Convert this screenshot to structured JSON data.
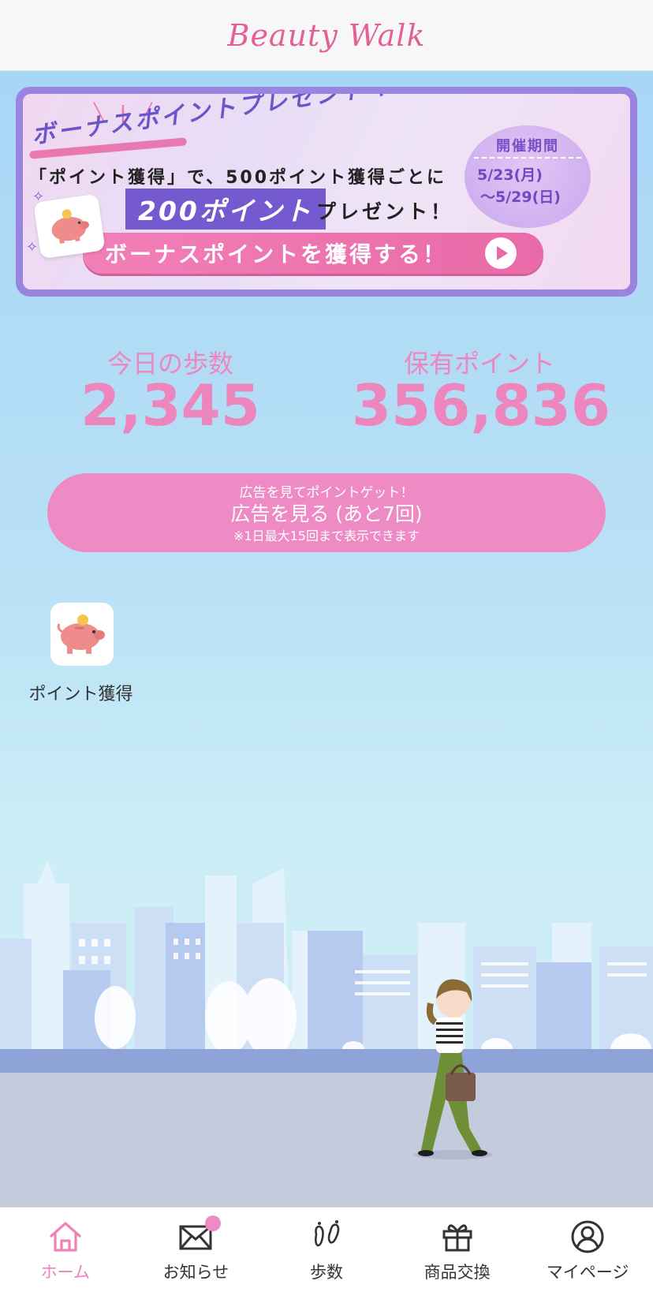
{
  "app": {
    "logo": "Beauty Walk"
  },
  "banner": {
    "title": "ボーナスポイントプレゼントキャンペーン",
    "line1": "「ポイント獲得」で、500ポイント獲得ごとに",
    "highlight": "200ポイント",
    "line2": "プレゼント！",
    "period_title": "開催期間",
    "period_start": "5/23(月)",
    "period_end": "〜5/29(日)",
    "cta": "ボーナスポイントを獲得する！"
  },
  "stats": {
    "steps_label": "今日の歩数",
    "steps_value": "2,345",
    "points_label": "保有ポイント",
    "points_value": "356,836"
  },
  "ad": {
    "sub": "広告を見てポイントゲット！",
    "main": "広告を見る (あと7回)",
    "note": "※1日最大15回まで表示できます"
  },
  "shortcut": {
    "label": "ポイント獲得"
  },
  "tabs": [
    {
      "label": "ホーム",
      "icon": "home-icon",
      "active": true
    },
    {
      "label": "お知らせ",
      "icon": "mail-icon",
      "badge": true
    },
    {
      "label": "歩数",
      "icon": "footprints-icon"
    },
    {
      "label": "商品交換",
      "icon": "gift-icon"
    },
    {
      "label": "マイページ",
      "icon": "user-icon"
    }
  ],
  "colors": {
    "accent": "#ee86be",
    "banner_purple": "#7459cf",
    "sky": "#a8d6f6"
  }
}
